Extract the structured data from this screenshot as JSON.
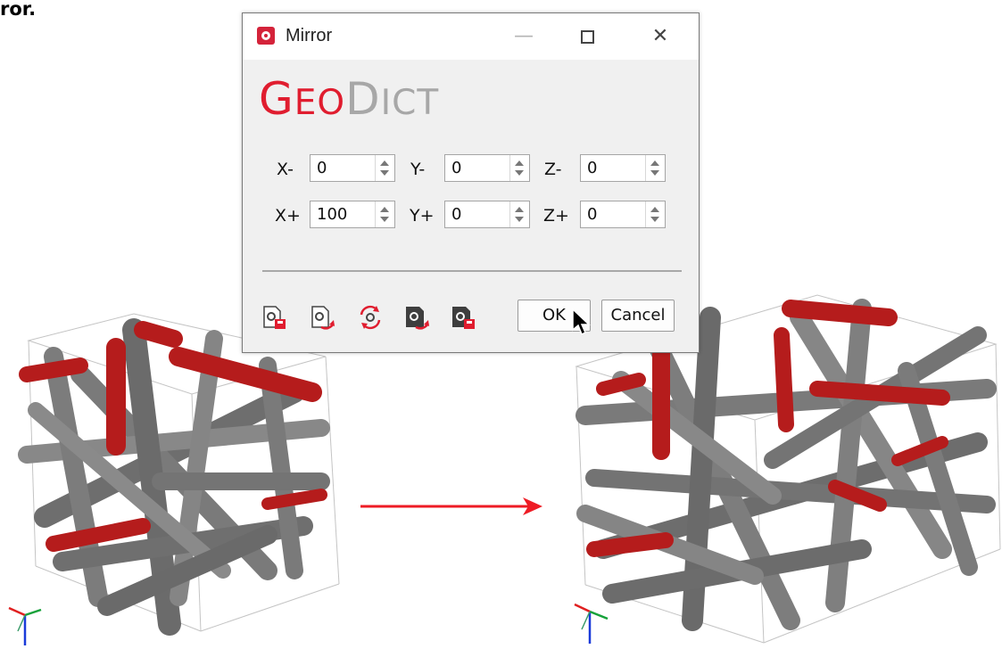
{
  "caption": {
    "fragment": "ror."
  },
  "dialog": {
    "title": "Mirror",
    "logo": {
      "part1_cap": "G",
      "part1_rest": "EO",
      "part2_cap": "D",
      "part2_rest": "ICT"
    },
    "controls": {
      "minimize": "—",
      "close": "✕"
    },
    "fields": {
      "x_minus": {
        "label": "X-",
        "value": "0"
      },
      "y_minus": {
        "label": "Y-",
        "value": "0"
      },
      "z_minus": {
        "label": "Z-",
        "value": "0"
      },
      "x_plus": {
        "label": "X+",
        "value": "100"
      },
      "y_plus": {
        "label": "Y+",
        "value": "0"
      },
      "z_plus": {
        "label": "Z+",
        "value": "0"
      }
    },
    "toolbar": {
      "icons": [
        "save-settings-icon",
        "load-settings-icon",
        "reset-settings-icon",
        "save-parameters-icon",
        "load-parameters-icon"
      ]
    },
    "buttons": {
      "ok": "OK",
      "cancel": "Cancel"
    }
  },
  "colors": {
    "accent_red": "#e01d2f",
    "fiber_red": "#b51c1c",
    "fiber_gray": "#7d7d7d",
    "arrow_red": "#ee1c25"
  },
  "scene": {
    "left_label": "",
    "right_label": ""
  }
}
